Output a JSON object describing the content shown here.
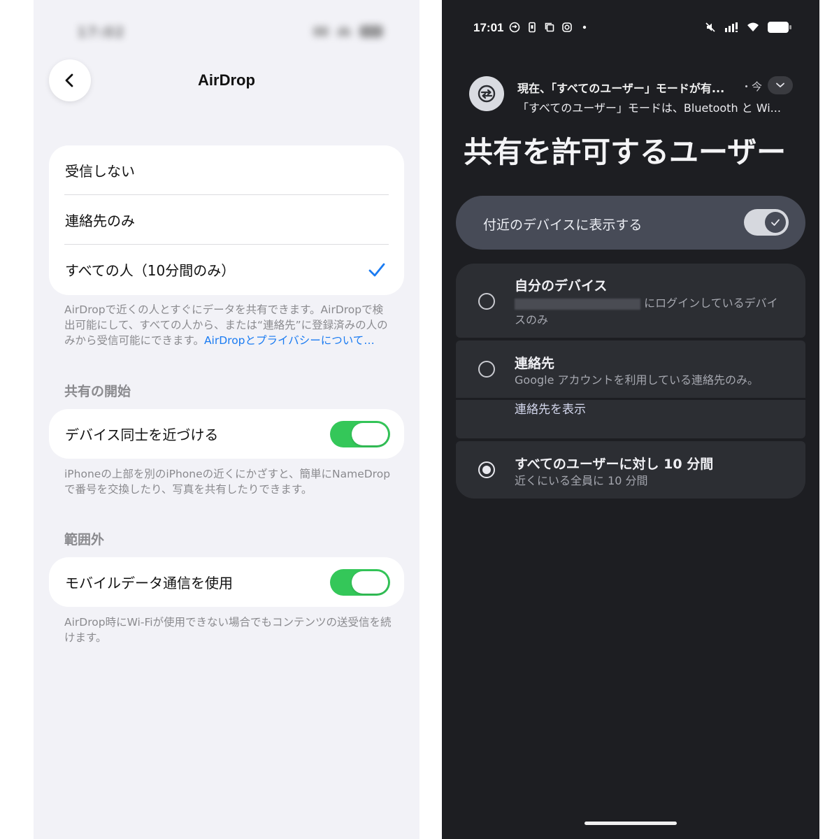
{
  "ios": {
    "status_time": "17:02",
    "nav_title": "AirDrop",
    "receive_options": [
      {
        "label": "受信しない",
        "selected": false
      },
      {
        "label": "連絡先のみ",
        "selected": false
      },
      {
        "label": "すべての人（10分間のみ）",
        "selected": true
      }
    ],
    "airdrop_footer": "AirDropで近くの人とすぐにデータを共有できます。AirDropで検出可能にして、すべての人から、または“連絡先”に登録済みの人のみから受信可能にできます。",
    "airdrop_footer_link": "AirDropとプライバシーについて…",
    "section_start_sharing": "共有の開始",
    "bring_devices_label": "デバイス同士を近づける",
    "bring_devices_on": true,
    "bring_devices_footer": "iPhoneの上部を別のiPhoneの近くにかざすと、簡単にNameDropで番号を交換したり、写真を共有したりできます。",
    "section_out_of_range": "範囲外",
    "mobile_data_label": "モバイルデータ通信を使用",
    "mobile_data_on": true,
    "mobile_data_footer": "AirDrop時にWi-Fiが使用できない場合でもコンテンツの送受信を続けます。",
    "colors": {
      "accent": "#1a7bf2",
      "toggle_on": "#34c759",
      "background": "#f2f2f7"
    }
  },
  "android": {
    "status_time": "17:01",
    "notification": {
      "title": "現在、「すべてのユーザー」モードが有...",
      "meta": "・今",
      "body": "「すべてのユーザー」モードは、Bluetooth と Wi..."
    },
    "heading": "共有を許可するユーザー",
    "visibility_toggle_label": "付近のデバイスに表示する",
    "visibility_toggle_on": true,
    "options": [
      {
        "title": "自分のデバイス",
        "subtitle_suffix": "にログインしているデバイ",
        "subtitle_line2": "スのみ",
        "selected": false
      },
      {
        "title": "連絡先",
        "subtitle": "Google アカウントを利用している連絡先のみ。",
        "link": "連絡先を表示",
        "selected": false
      },
      {
        "title": "すべてのユーザーに対し 10 分間",
        "subtitle": "近くにいる全員に 10 分間",
        "selected": true
      }
    ],
    "colors": {
      "background": "#1d1e22",
      "card": "#2c2e33",
      "toggle_card": "#474b57"
    }
  }
}
